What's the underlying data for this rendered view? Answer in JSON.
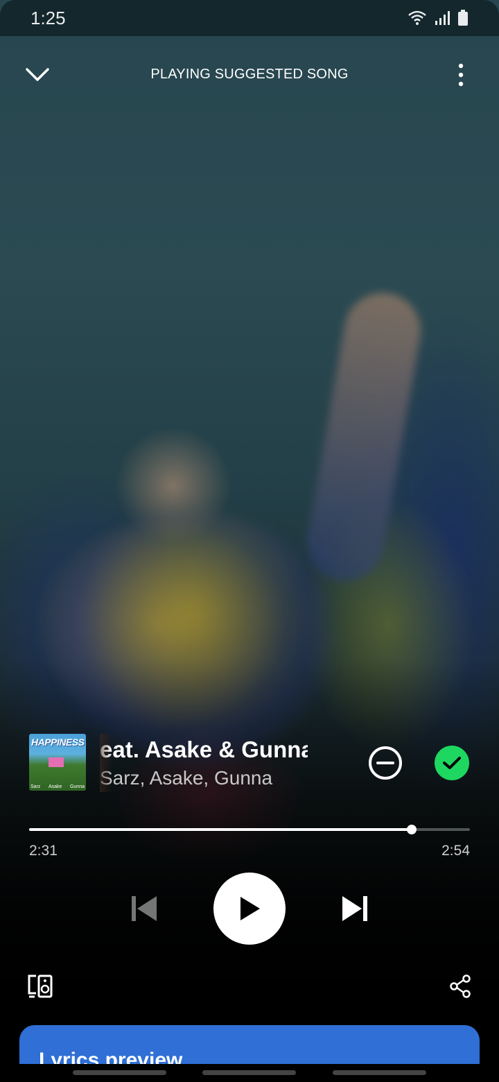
{
  "status_bar": {
    "time": "1:25",
    "icons": [
      "wifi-icon",
      "signal-icon",
      "battery-icon"
    ]
  },
  "header": {
    "title": "PLAYING SUGGESTED SONG",
    "icons": [
      "chevron-down-icon",
      "more-vertical-icon"
    ]
  },
  "track": {
    "title": "Happiness (feat. Asake & Gunna)",
    "artists": "Sarz, Asake, Gunna",
    "cover": {
      "title": "HAPPINESS",
      "credits": [
        "Sarz",
        "Asake",
        "Gunna"
      ]
    },
    "saved": true
  },
  "playback": {
    "elapsed": "2:31",
    "total": "2:54",
    "progress_fraction": 0.868,
    "state": "paused"
  },
  "colors": {
    "accent_green": "#1ed760",
    "lyrics_card": "#2f6fd6"
  },
  "lyrics": {
    "title": "Lyrics preview"
  }
}
